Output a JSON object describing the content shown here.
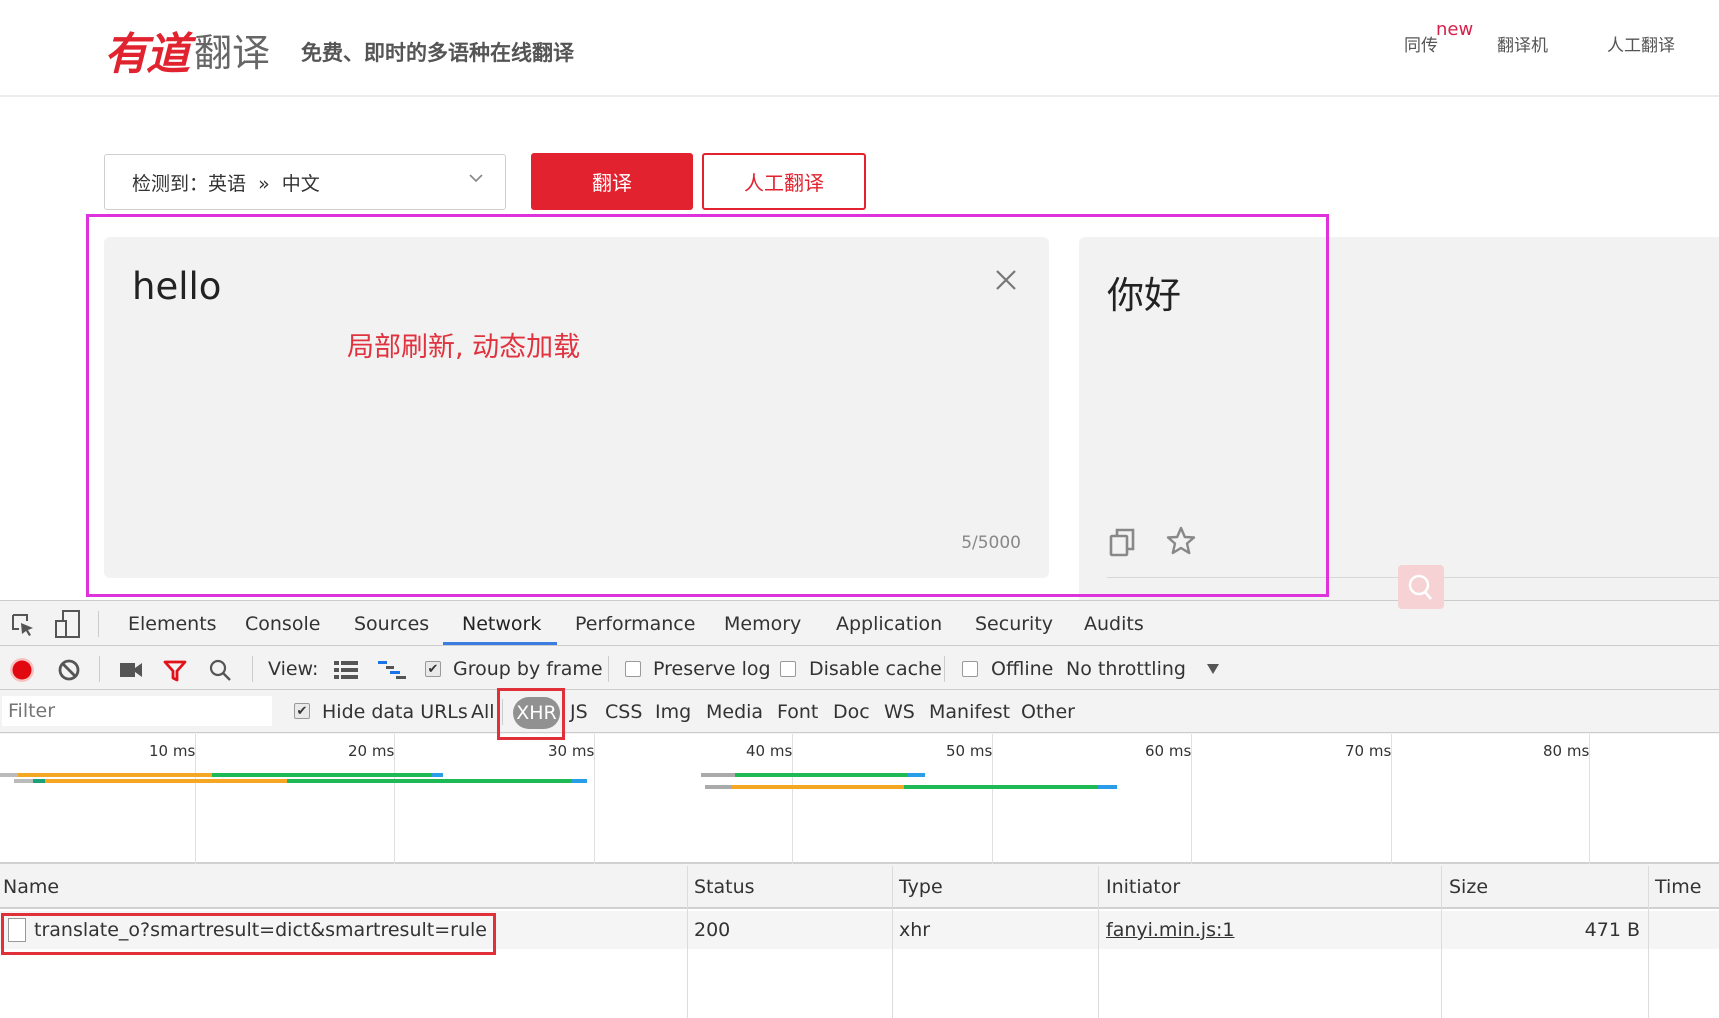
{
  "header": {
    "logo_mark": "有道",
    "logo_text": "翻译",
    "slogan": "免费、即时的多语种在线翻译",
    "nav": [
      {
        "label": "同传",
        "badge": "new"
      },
      {
        "label": "翻译机"
      },
      {
        "label": "人工翻译"
      }
    ]
  },
  "controls": {
    "language_select": "检测到：英语  »  中文",
    "translate_button": "翻译",
    "human_translate_button": "人工翻译"
  },
  "input": {
    "text": "hello",
    "char_count": "5/5000"
  },
  "annotation": {
    "text": "局部刷新, 动态加载"
  },
  "output": {
    "text": "你好"
  },
  "devtools": {
    "tabs": [
      "Elements",
      "Console",
      "Sources",
      "Network",
      "Performance",
      "Memory",
      "Application",
      "Security",
      "Audits"
    ],
    "active_tab": "Network",
    "toolbar": {
      "view_label": "View:",
      "group_by_frame": {
        "label": "Group by frame",
        "checked": true
      },
      "preserve_log": {
        "label": "Preserve log",
        "checked": false
      },
      "disable_cache": {
        "label": "Disable cache",
        "checked": false
      },
      "offline": {
        "label": "Offline",
        "checked": false
      },
      "throttling": "No throttling"
    },
    "filter": {
      "placeholder": "Filter",
      "hide_data_urls": {
        "label": "Hide data URLs",
        "checked": true
      },
      "types": [
        "All",
        "XHR",
        "JS",
        "CSS",
        "Img",
        "Media",
        "Font",
        "Doc",
        "WS",
        "Manifest",
        "Other"
      ],
      "active_type": "XHR"
    },
    "timeline": {
      "ticks": [
        "10 ms",
        "20 ms",
        "30 ms",
        "40 ms",
        "50 ms",
        "60 ms",
        "70 ms",
        "80 ms"
      ]
    },
    "table": {
      "columns": [
        "Name",
        "Status",
        "Type",
        "Initiator",
        "Size",
        "Time"
      ],
      "rows": [
        {
          "name": "translate_o?smartresult=dict&smartresult=rule",
          "status": "200",
          "type": "xhr",
          "initiator": "fanyi.min.js:1",
          "size": "471 B",
          "time": ""
        }
      ]
    }
  },
  "colors": {
    "brand_red": "#e3222f",
    "annotation_magenta": "#dd32dc",
    "highlight_red": "#e0303a",
    "devtools_accent": "#3b7ce0"
  }
}
